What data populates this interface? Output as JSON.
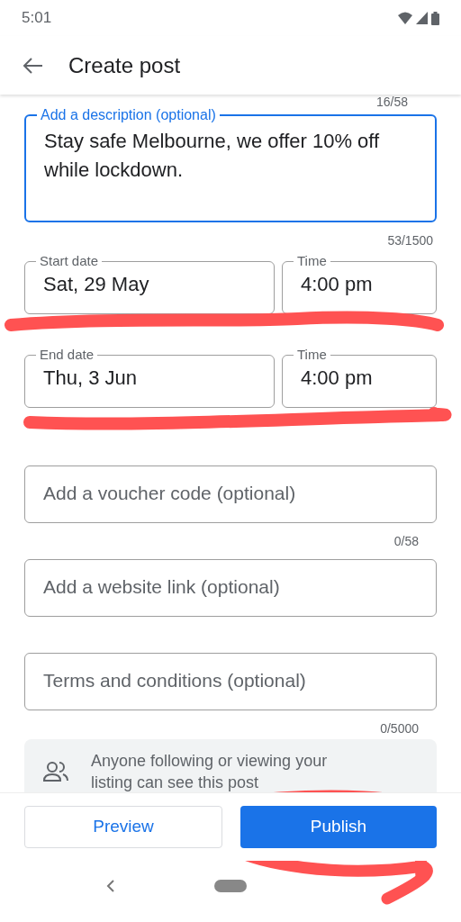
{
  "status_bar": {
    "time": "5:01"
  },
  "app_bar": {
    "title": "Create post"
  },
  "title_counter": "16/58",
  "description": {
    "label": "Add a description (optional)",
    "value": "Stay safe Melbourne, we offer 10% off while lockdown.",
    "focused": true,
    "counter": "53/1500"
  },
  "date_rows": [
    {
      "date_label": "Start date",
      "date": "Sat, 29 May",
      "time_label": "Time",
      "time": "4:00 pm"
    },
    {
      "date_label": "End date",
      "date": "Thu, 3 Jun",
      "time_label": "Time",
      "time": "4:00 pm"
    }
  ],
  "inputs": [
    {
      "placeholder": "Add a voucher code (optional)",
      "counter": "0/58"
    },
    {
      "placeholder": "Add a website link (optional)"
    },
    {
      "placeholder": "Terms and conditions (optional)",
      "counter": "0/5000"
    }
  ],
  "notice": {
    "text": "Anyone following or viewing your listing can see this post"
  },
  "buttons": [
    {
      "label": "Preview",
      "kind": "outlined"
    },
    {
      "label": "Publish",
      "kind": "filled"
    }
  ]
}
